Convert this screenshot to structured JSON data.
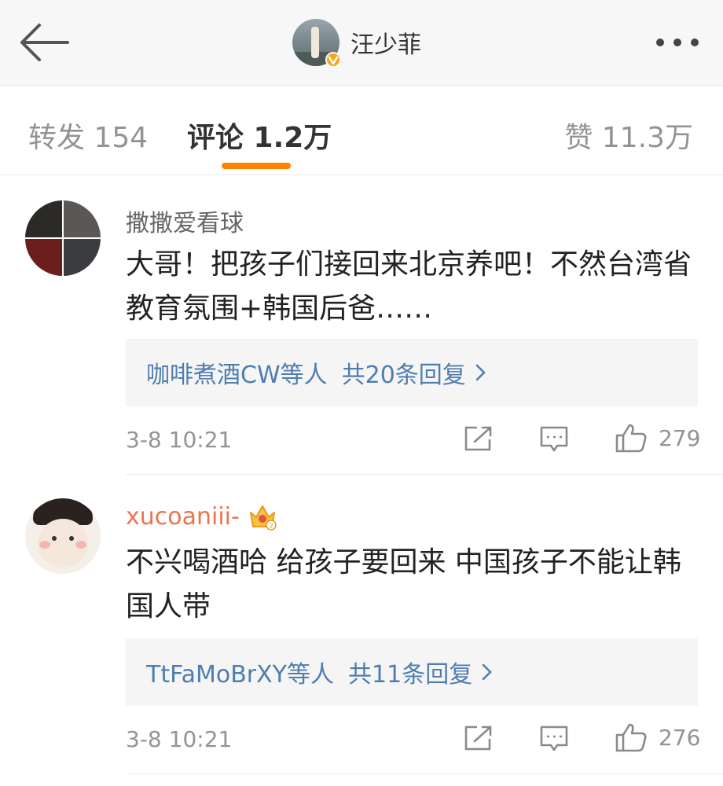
{
  "header": {
    "title": "汪少菲",
    "avatar_icon": "verified-user-avatar",
    "more_icon": "more-dots-icon",
    "back_icon": "back-arrow-icon"
  },
  "tabs": {
    "repost": "转发 154",
    "comment": "评论 1.2万",
    "like": "赞 11.3万",
    "active": "comment",
    "accent_color": "#ff8200"
  },
  "comments": [
    {
      "username": "撒撒爱看球",
      "username_color": "#666666",
      "text": "大哥！把孩子们接回来北京养吧！不然台湾省教育氛围+韩国后爸……",
      "reply_names": "咖啡煮酒CW等人",
      "reply_count": "共20条回复",
      "time": "3-8 10:21",
      "likes": "279"
    },
    {
      "username": "xucoaniii-",
      "username_color": "#eb7350",
      "text": "不兴喝酒哈 给孩子要回来 中国孩子不能让韩国人带",
      "reply_names": "TtFaMoBrXY等人",
      "reply_count": "共11条回复",
      "time": "3-8 10:21",
      "likes": "276"
    }
  ],
  "colors": {
    "link": "#507daf",
    "muted": "#939393",
    "vip_badge": "#f5a623"
  }
}
